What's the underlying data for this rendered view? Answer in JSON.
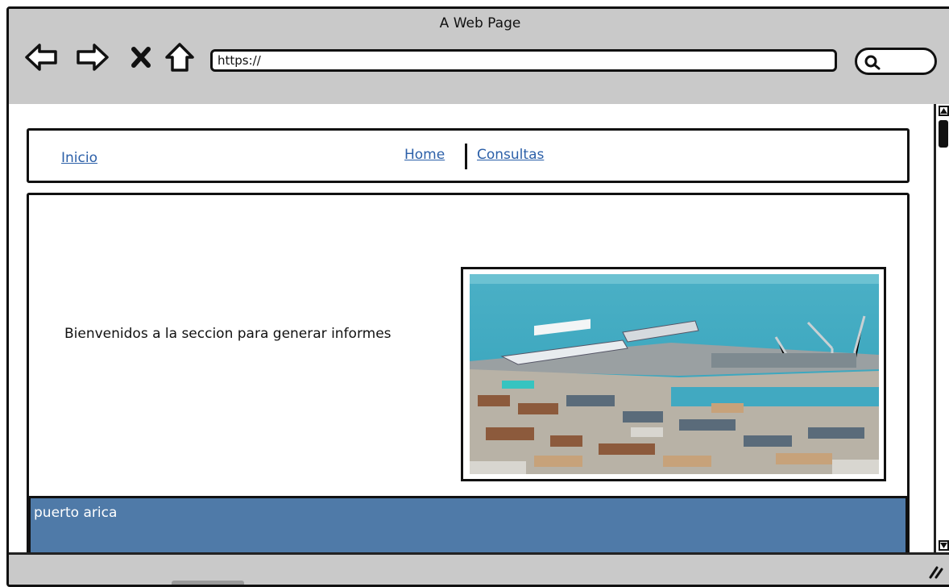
{
  "browser": {
    "window_title": "A Web Page",
    "url": "https://",
    "icons": {
      "back": "back-arrow-icon",
      "forward": "forward-arrow-icon",
      "stop": "close-icon",
      "home": "home-icon",
      "search": "search-icon"
    }
  },
  "nav": {
    "inicio": "Inicio",
    "home": "Home",
    "consultas": "Consultas"
  },
  "main": {
    "welcome_text": "Bienvenidos a la seccion para generar informes"
  },
  "footer": {
    "text": "puerto arica"
  },
  "colors": {
    "link": "#2b5fa8",
    "footer_bg": "#4f7aa8",
    "chrome": "#c9c9c9"
  }
}
